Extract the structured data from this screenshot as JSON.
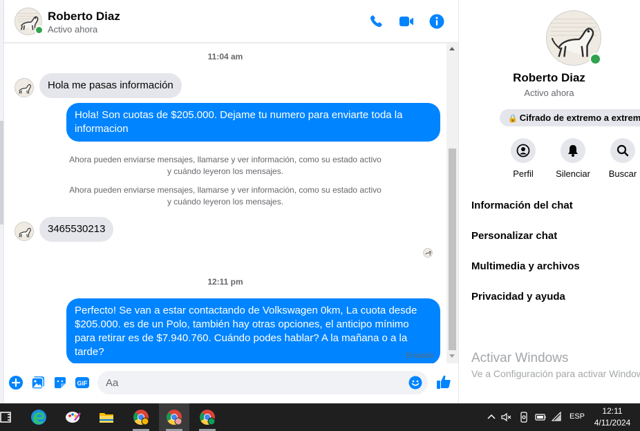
{
  "contact": {
    "name": "Roberto Diaz",
    "status": "Activo ahora"
  },
  "header": {
    "icons": [
      "phone-icon",
      "video-camera-icon",
      "info-icon"
    ]
  },
  "messages": {
    "timestamp_1": "11:04 am",
    "incoming_1": "Hola me pasas información",
    "outgoing_1": "Hola! Son cuotas de $205.000. Dejame tu numero para enviarte toda la informacion",
    "system_1": "Ahora pueden enviarse mensajes, llamarse y ver información, como su estado activo y cuándo leyeron los mensajes.",
    "system_2": "Ahora pueden enviarse mensajes, llamarse y ver información, como su estado activo y cuándo leyeron los mensajes.",
    "incoming_2": "3465530213",
    "timestamp_2": "12:11 pm",
    "outgoing_2": "Perfecto!  Se van a estar contactando de Volkswagen 0km, La cuota desde $205.000. es de un Polo, también hay otras opciones, el anticipo mínimo para retirar es de $7.940.760. Cuándo podes hablar? A la mañana o a la tarde?",
    "delivery_status": "Enviado"
  },
  "composer": {
    "placeholder": "Aa",
    "gif_label": "GIF"
  },
  "info_panel": {
    "name": "Roberto Diaz",
    "status": "Activo ahora",
    "encryption": "Cifrado de extremo a extremo",
    "actions": [
      {
        "label": "Perfil",
        "icon": "profile-icon"
      },
      {
        "label": "Silenciar",
        "icon": "bell-icon"
      },
      {
        "label": "Buscar",
        "icon": "search-icon"
      }
    ],
    "menu": [
      "Información del chat",
      "Personalizar chat",
      "Multimedia y archivos",
      "Privacidad y ayuda"
    ]
  },
  "watermark": {
    "title": "Activar Windows",
    "subtitle": "Ve a Configuración para activar Windows."
  },
  "taskbar": {
    "language": "ESP",
    "time": "12:11",
    "date": "4/11/2024"
  },
  "colors": {
    "accent": "#0084ff",
    "incoming_bubble": "#e4e6eb",
    "online": "#31a24c",
    "taskbar": "#1f1f1f"
  }
}
